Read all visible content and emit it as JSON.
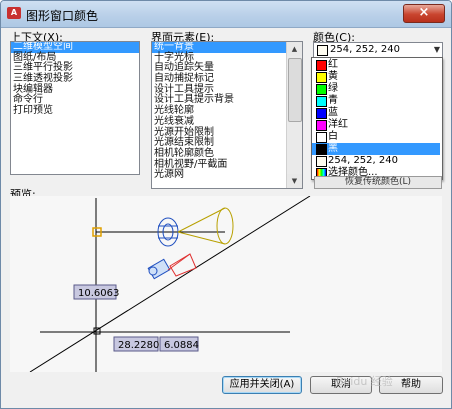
{
  "window": {
    "title": "图形窗口颜色",
    "app_icon": "autocad-icon",
    "close_label": "×"
  },
  "context": {
    "label": "上下文(X):",
    "items": [
      "二维模型空间",
      "图纸/布局",
      "三维平行投影",
      "三维透视投影",
      "块编辑器",
      "命令行",
      "打印预览"
    ],
    "selected_index": 0
  },
  "elements": {
    "label": "界面元素(E):",
    "items": [
      "统一背景",
      "十字光标",
      "自动追踪矢量",
      "自动捕捉标记",
      "设计工具提示",
      "设计工具提示背景",
      "光线轮廓",
      "光线衰减",
      "光源开始限制",
      "光源结束限制",
      "相机轮廓颜色",
      "相机视野/平截面",
      "光源网"
    ],
    "selected_index": 0
  },
  "color": {
    "label": "颜色(C):",
    "selected_value": "254, 252, 240",
    "selected_swatch": "#fefcf0",
    "options": [
      {
        "label": "红",
        "color": "#ff0000"
      },
      {
        "label": "黄",
        "color": "#ffff00"
      },
      {
        "label": "绿",
        "color": "#00ff00"
      },
      {
        "label": "青",
        "color": "#00ffff"
      },
      {
        "label": "蓝",
        "color": "#0000ff"
      },
      {
        "label": "洋红",
        "color": "#ff00ff"
      },
      {
        "label": "白",
        "color": "#ffffff"
      },
      {
        "label": "黑",
        "color": "#000000"
      },
      {
        "label": "254, 252, 240",
        "color": "#fefcf0"
      },
      {
        "label": "选择颜色...",
        "color": "multi"
      }
    ],
    "highlighted_index": 7,
    "restore_label": "恢复传统颜色(L)"
  },
  "preview": {
    "label": "预览:",
    "dim_values": [
      "10.6063",
      "28.2280",
      "6.0884"
    ]
  },
  "buttons": {
    "apply": "应用并关闭(A)",
    "cancel": "取消",
    "help": "帮助"
  },
  "watermark": "Baidu 经验"
}
